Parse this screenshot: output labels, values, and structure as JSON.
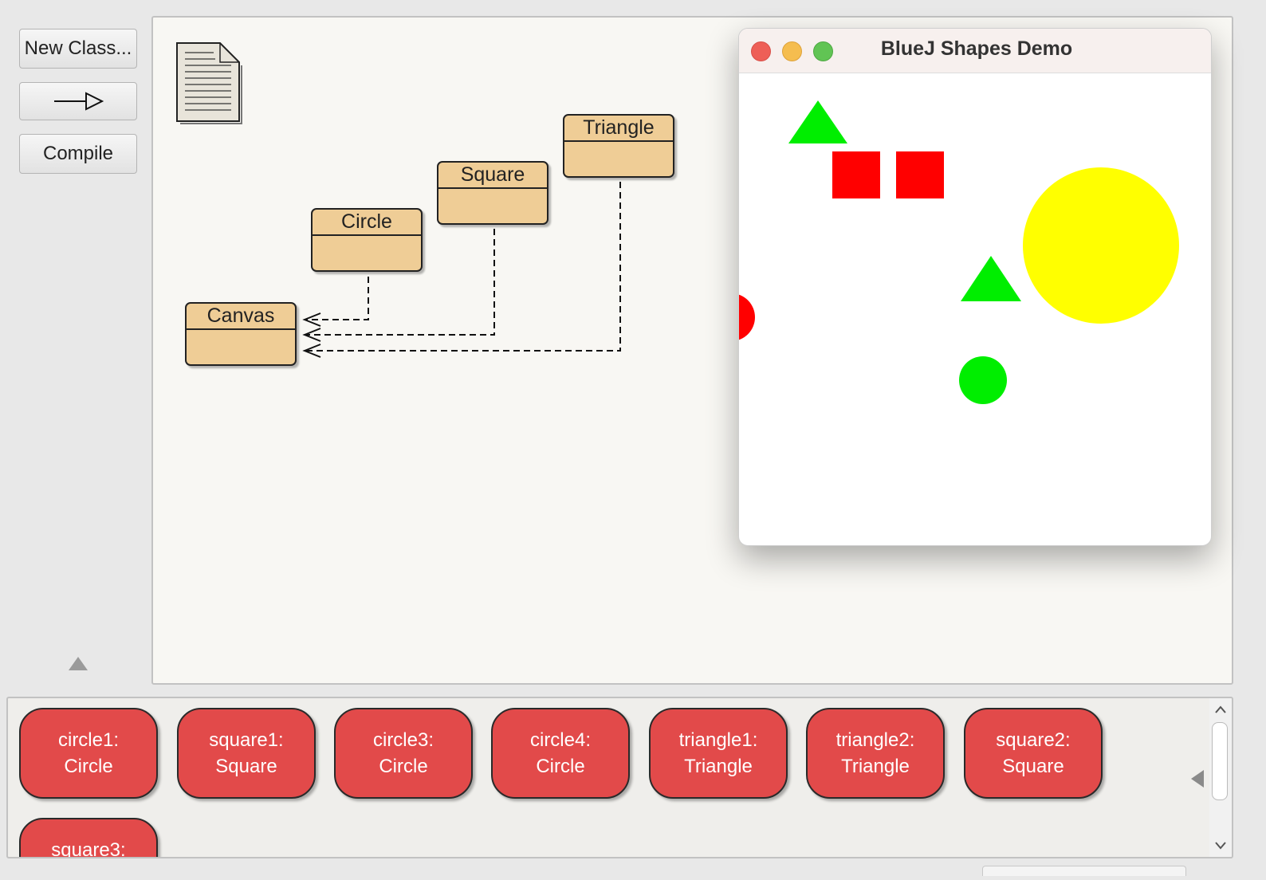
{
  "toolbar": {
    "new_class_label": "New Class...",
    "inheritance_arrow_icon": "inheritance-arrow",
    "compile_label": "Compile"
  },
  "diagram": {
    "readme_icon": "document-icon",
    "classes": [
      {
        "name": "Canvas"
      },
      {
        "name": "Circle"
      },
      {
        "name": "Square"
      },
      {
        "name": "Triangle"
      }
    ]
  },
  "shapes_window": {
    "title": "BlueJ Shapes Demo",
    "colors": {
      "red": "#ff0000",
      "green": "#00ee00",
      "yellow": "#ffff00"
    },
    "shapes": [
      "green triangle",
      "red square",
      "red square",
      "yellow circle",
      "green triangle",
      "red circle",
      "green circle"
    ]
  },
  "object_bench": {
    "objects": [
      {
        "name": "circle1:",
        "type": "Circle"
      },
      {
        "name": "square1:",
        "type": "Square"
      },
      {
        "name": "circle3:",
        "type": "Circle"
      },
      {
        "name": "circle4:",
        "type": "Circle"
      },
      {
        "name": "triangle1:",
        "type": "Triangle"
      },
      {
        "name": "triangle2:",
        "type": "Triangle"
      },
      {
        "name": "square2:",
        "type": "Square"
      },
      {
        "name": "square3:",
        "type": ""
      }
    ]
  },
  "colors": {
    "class_fill": "#efcd96",
    "object_fill": "#e24a4a",
    "diagram_bg": "#f8f7f3"
  }
}
